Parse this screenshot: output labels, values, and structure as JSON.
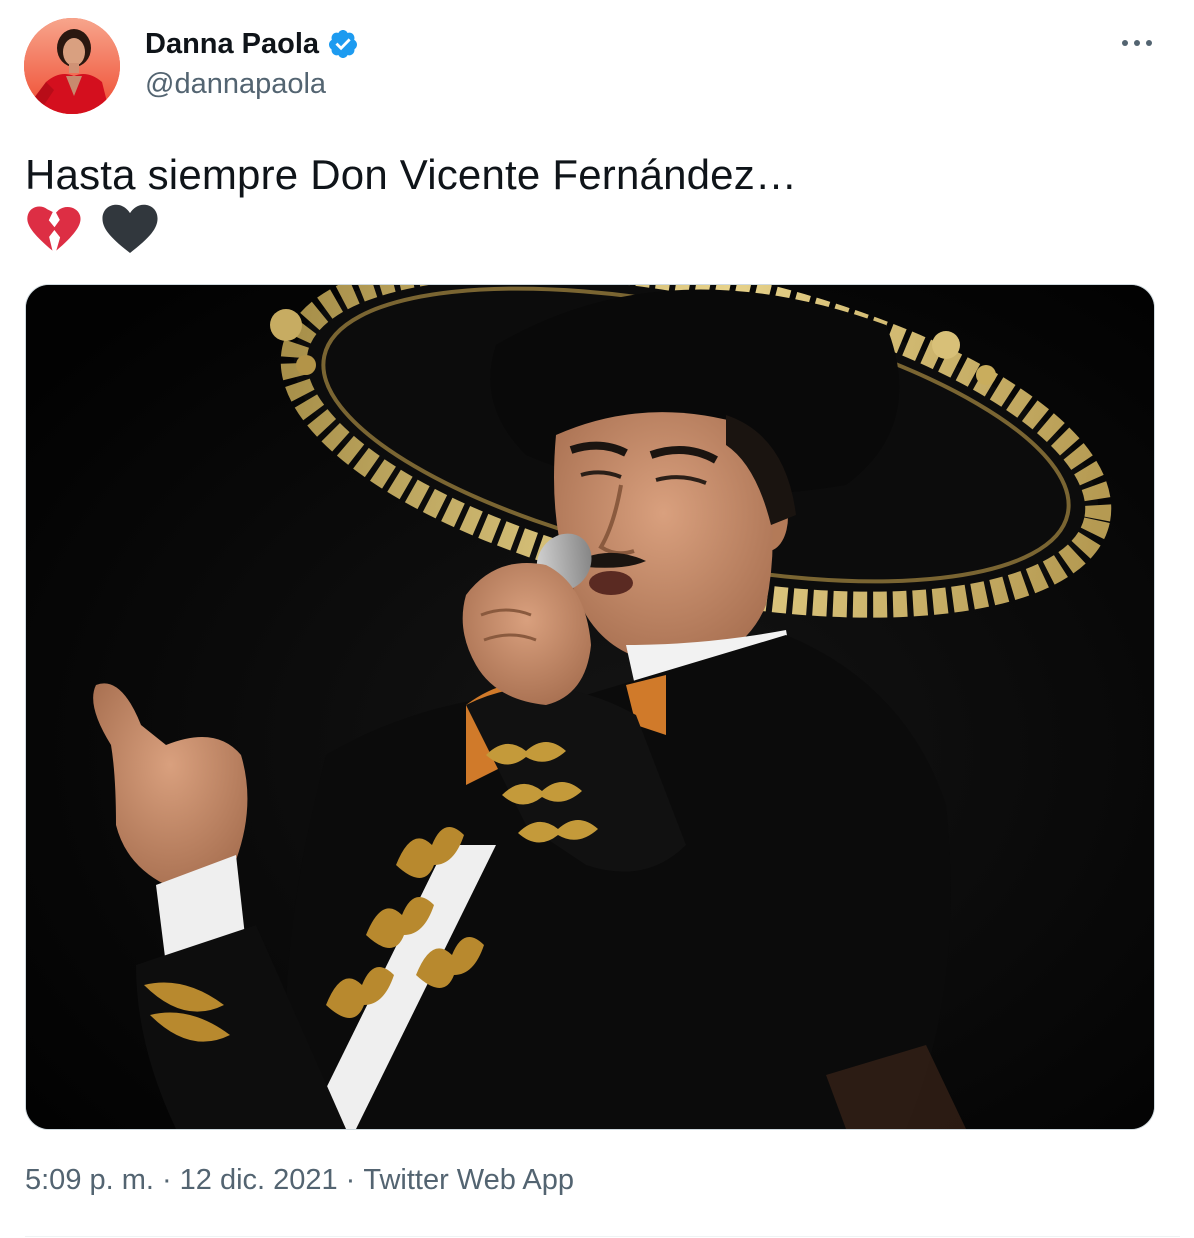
{
  "author": {
    "display_name": "Danna Paola",
    "handle": "@dannapaola",
    "verified": true,
    "avatar_icon": "profile-photo-red-outfit"
  },
  "header": {
    "more_icon": "more-options-icon"
  },
  "tweet": {
    "text": "Hasta siempre Don Vicente Fernández…",
    "emojis": [
      "broken-heart-emoji",
      "black-heart-emoji"
    ]
  },
  "media": {
    "kind": "photo"
  },
  "meta": {
    "time": "5:09 p. m.",
    "separator": "·",
    "date": "12 dic. 2021",
    "source": "Twitter Web App"
  },
  "colors": {
    "text_primary": "#0f1419",
    "text_secondary": "#536471",
    "verified_blue": "#1d9bf0",
    "border": "#cfd9de",
    "broken_heart_red": "#dd2e44",
    "black_heart": "#31373d"
  }
}
